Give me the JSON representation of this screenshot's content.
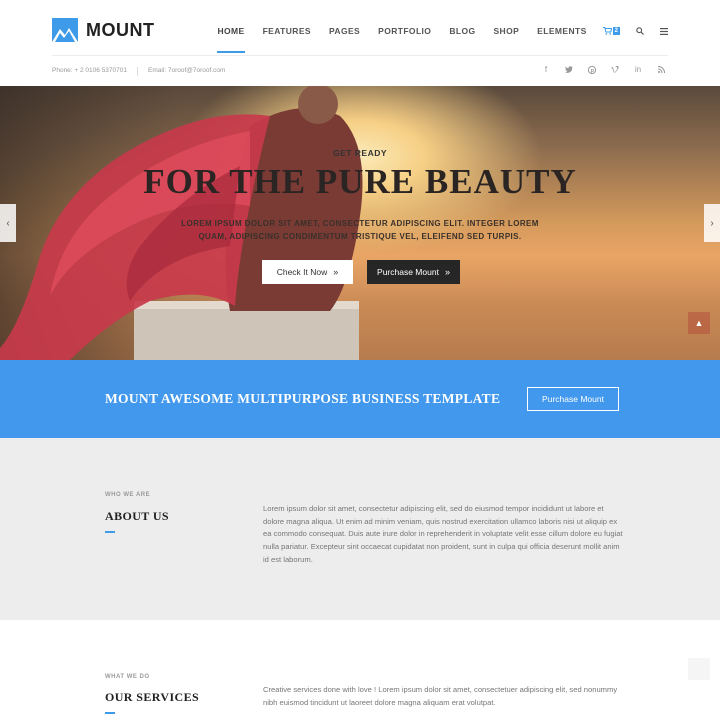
{
  "header": {
    "logo_text": "MOUNT",
    "nav": [
      {
        "label": "HOME",
        "active": true
      },
      {
        "label": "FEATURES"
      },
      {
        "label": "PAGES"
      },
      {
        "label": "PORTFOLIO"
      },
      {
        "label": "BLOG"
      },
      {
        "label": "SHOP"
      },
      {
        "label": "ELEMENTS"
      }
    ],
    "cart_count": "2",
    "icons": [
      "cart-icon",
      "search-icon",
      "menu-icon"
    ],
    "phone": "Phone: + 2 0106 5370701",
    "email": "Email: 7oroof@7oroof.com",
    "socials": [
      "facebook-icon",
      "twitter-icon",
      "pinterest-icon",
      "vimeo-icon",
      "linkedin-icon",
      "rss-icon"
    ]
  },
  "hero": {
    "pre_title": "GET READY",
    "title": "FOR THE PURE BEAUTY",
    "subtitle": "LOREM IPSUM DOLOR SIT AMET, CONSECTETUR ADIPISCING ELIT. INTEGER LOREM QUAM, ADIPISCING CONDIMENTUM TRISTIQUE VEL, ELEIFEND SED TURPIS.",
    "btn_primary": "Check It Now",
    "btn_secondary": "Purchase Mount"
  },
  "promo": {
    "text": "MOUNT AWESOME MULTIPURPOSE BUSINESS TEMPLATE",
    "button": "Purchase Mount"
  },
  "about": {
    "kicker": "WHO WE ARE",
    "title": "ABOUT US",
    "body": "Lorem ipsum dolor sit amet, consectetur adipiscing elit, sed do eiusmod tempor incididunt ut labore et dolore magna aliqua. Ut enim ad minim veniam, quis nostrud exercitation ullamco laboris nisi ut aliquip ex ea commodo consequat. Duis aute irure dolor in reprehenderit in voluptate velit esse cillum dolore eu fugiat nulla pariatur. Excepteur sint occaecat cupidatat non proident, sunt in culpa qui officia deserunt mollit anim id est laborum."
  },
  "services": {
    "kicker": "WHAT WE DO",
    "title": "OUR SERVICES",
    "body": "Creative services done with love ! Lorem ipsum dolor sit amet, consectetuer adipiscing elit, sed nonummy nibh euismod tincidunt ut laoreet dolore magna aliquam erat volutpat."
  },
  "colors": {
    "accent": "#3d9be9",
    "promo_bg": "#4198ec",
    "about_bg": "#ededed",
    "dark_button": "#262626"
  }
}
